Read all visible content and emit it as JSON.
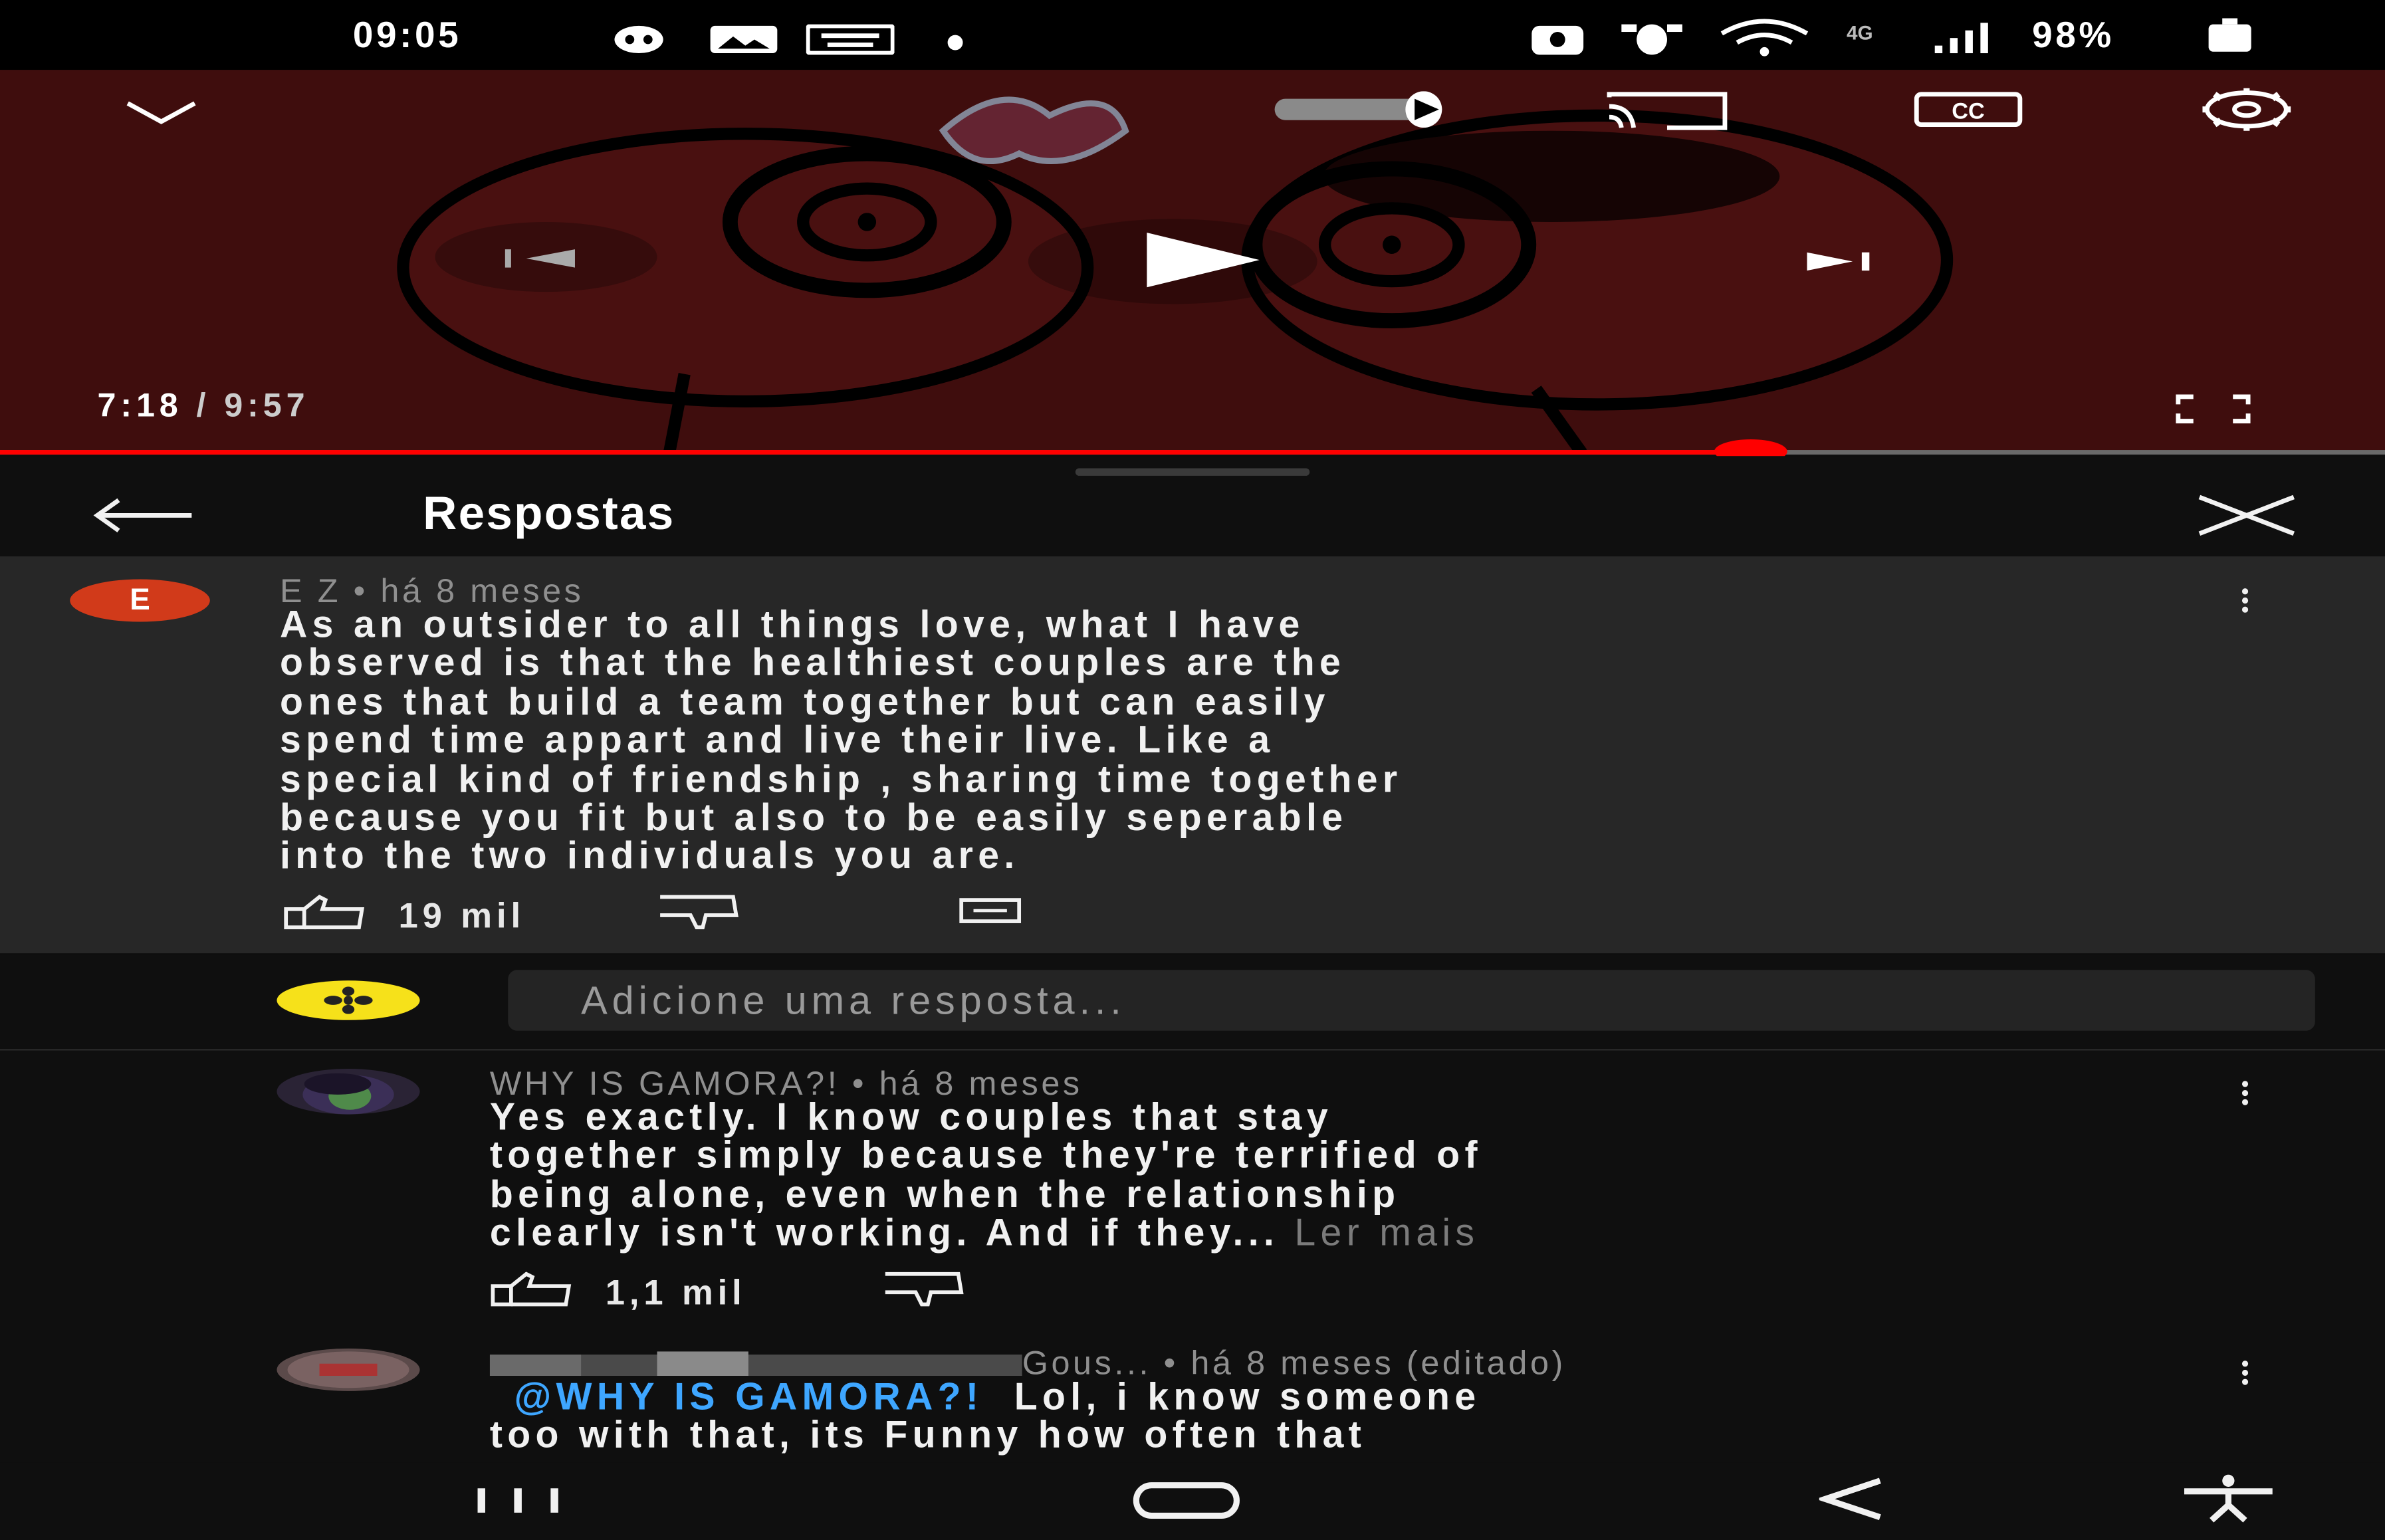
{
  "status_bar": {
    "time": "09:05",
    "battery": "98%",
    "network": "4G",
    "icons": [
      "notification-icon",
      "gallery-icon",
      "keyboard-icon",
      "dot-icon",
      "bluetooth-icon",
      "alarm-icon",
      "wifi-icon",
      "signal-icon",
      "battery-icon"
    ]
  },
  "player": {
    "time_current": "7:18",
    "time_separator": " / ",
    "time_total": "9:57",
    "progress": 0.734,
    "accent_color": "#ff0000",
    "icons": [
      "collapse-chevron-icon",
      "autoplay-toggle-icon",
      "cast-icon",
      "captions-icon",
      "settings-gear-icon",
      "previous-icon",
      "play-icon",
      "next-icon",
      "fullscreen-icon"
    ]
  },
  "sheet": {
    "title": "Respostas",
    "icons": [
      "back-arrow-icon",
      "close-icon"
    ]
  },
  "root_comment": {
    "avatar_letter": "E",
    "avatar_color": "#d13a1a",
    "meta": "E Z • há 8 meses",
    "lines": [
      "As an outsider to all things love, what I have",
      "observed is that the healthiest couples are the",
      "ones that build a team together but can easily",
      "spend time appart and live their live. Like a",
      "special kind of friendship , sharing time together",
      "because you fit but also to be easily seperable",
      "into the two individuals you are."
    ],
    "likes": "19 mil"
  },
  "reply_box": {
    "placeholder": "Adicione uma resposta..."
  },
  "replies": [
    {
      "meta": "WHY IS GAMORA?! • há 8 meses",
      "lines": [
        "Yes exactly. I know couples that stay",
        "together simply because they're terrified of",
        "being alone, even when the relationship"
      ],
      "last_line": "clearly isn't working. And if they...",
      "read_more": "Ler mais",
      "likes": "1,1 mil"
    },
    {
      "meta_name": "Gous",
      "meta_suffix": "... • há 8 meses (editado)",
      "mention": "@WHY IS GAMORA?!",
      "line1_rest": "Lol, i know someone",
      "line2": "too with that, its Funny how often that"
    }
  ],
  "nav_bar": {
    "icons": [
      "recent-apps-icon",
      "home-icon",
      "back-icon",
      "accessibility-icon"
    ]
  }
}
